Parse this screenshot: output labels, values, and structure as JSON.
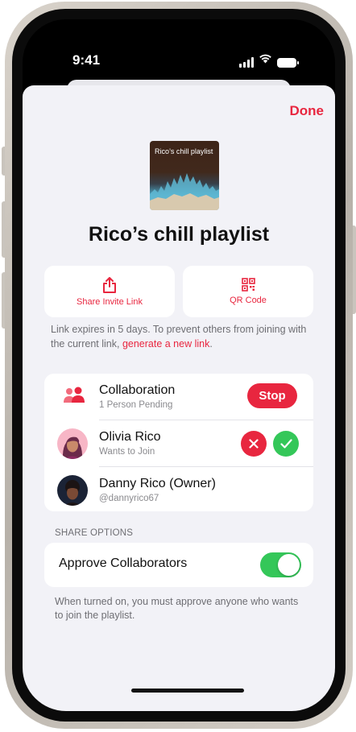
{
  "status_bar": {
    "time": "9:41",
    "signal_icon": "signal-bars-icon",
    "wifi_icon": "wifi-icon",
    "battery_icon": "battery-icon"
  },
  "sheet": {
    "done_label": "Done",
    "artwork_title": "Rico’s chill playlist",
    "playlist_title": "Rico’s chill playlist",
    "share_buttons": [
      {
        "icon": "share-icon",
        "label": "Share Invite Link"
      },
      {
        "icon": "qr-code-icon",
        "label": "QR Code"
      }
    ],
    "link_note": {
      "text": "Link expires in 5 days. To prevent others from joining with the current link, ",
      "link": "generate a new link",
      "end": "."
    },
    "collaboration": {
      "icon": "people-icon",
      "title": "Collaboration",
      "subtitle": "1 Person Pending",
      "stop_label": "Stop"
    },
    "members": [
      {
        "name": "Olivia Rico",
        "detail": "Wants to Join",
        "decline_icon": "x-icon",
        "approve_icon": "checkmark-icon"
      },
      {
        "name": "Danny Rico (Owner)",
        "detail": "@dannyrico67"
      }
    ],
    "share_options": {
      "header": "SHARE OPTIONS",
      "approve_label": "Approve Collaborators",
      "approve_enabled": true,
      "footnote": "When turned on, you must approve anyone who wants to join the playlist."
    }
  },
  "colors": {
    "accent_red": "#e8263f",
    "green": "#34c759",
    "background": "#f2f2f7"
  }
}
